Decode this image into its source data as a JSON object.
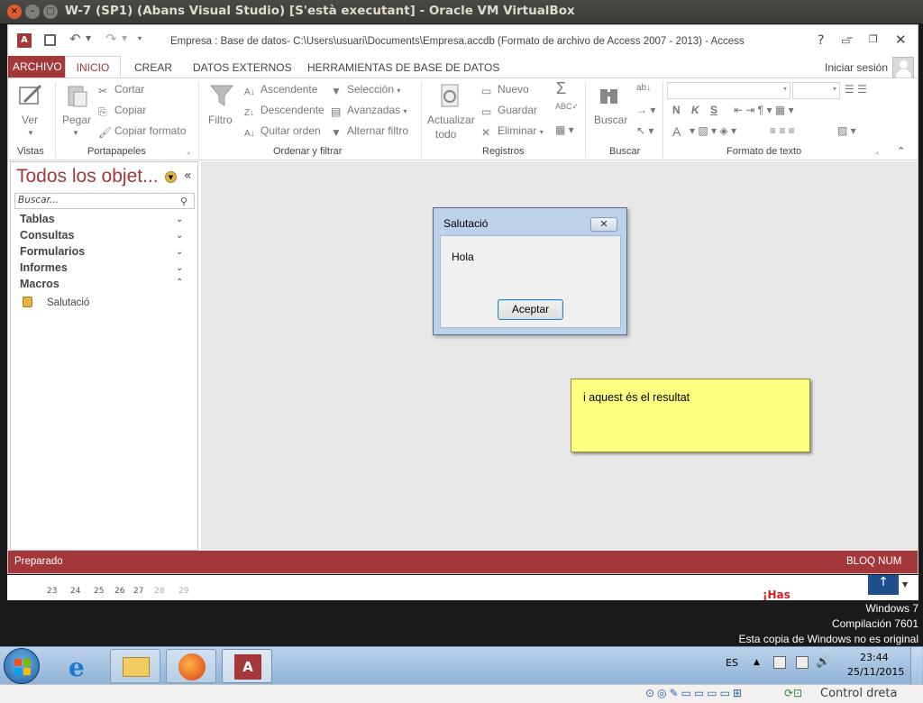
{
  "vbox": {
    "title": "W-7 (SP1) (Abans Visual Studio) [S'està executant] - Oracle VM VirtualBox",
    "host_key_label": "Control dreta"
  },
  "access": {
    "doc_title": "Empresa : Base de datos- C:\\Users\\usuari\\Documents\\Empresa.accdb (Formato de archivo de Access 2007 - 2013) - Access",
    "help": "?",
    "signin": "Iniciar sesión",
    "tabs": [
      "ARCHIVO",
      "INICIO",
      "CREAR",
      "DATOS EXTERNOS",
      "HERRAMIENTAS DE BASE DE DATOS"
    ],
    "ribbon": {
      "vistas": {
        "label": "Vistas",
        "ver": "Ver"
      },
      "portapapeles": {
        "label": "Portapapeles",
        "pegar": "Pegar",
        "cortar": "Cortar",
        "copiar": "Copiar",
        "copiar_formato": "Copiar formato"
      },
      "ordenar": {
        "label": "Ordenar y filtrar",
        "filtro": "Filtro",
        "ascendente": "Ascendente",
        "descendente": "Descendente",
        "quitar_orden": "Quitar orden",
        "seleccion": "Selección",
        "avanzadas": "Avanzadas",
        "alternar_filtro": "Alternar filtro"
      },
      "registros": {
        "label": "Registros",
        "actualizar": "Actualizar",
        "todo": "todo",
        "nuevo": "Nuevo",
        "guardar": "Guardar",
        "eliminar": "Eliminar"
      },
      "buscar": {
        "label": "Buscar",
        "buscar": "Buscar"
      },
      "formato": {
        "label": "Formato de texto",
        "bold": "N",
        "italic": "K",
        "underline": "S",
        "font_color": "A"
      }
    },
    "nav": {
      "title": "Todos los objet...",
      "search_placeholder": "Buscar...",
      "categories": [
        "Tablas",
        "Consultas",
        "Formularios",
        "Informes",
        "Macros"
      ],
      "macro_item": "Salutació"
    },
    "status": {
      "left": "Preparado",
      "right": "BLOQ NUM"
    }
  },
  "msgbox": {
    "title": "Salutació",
    "message": "Hola",
    "ok": "Aceptar"
  },
  "note": {
    "text": "i aquest és el resultat"
  },
  "calendar_strip": {
    "days": [
      "23",
      "24",
      "25",
      "26",
      "27",
      "28",
      "29"
    ],
    "partial_text": "¡Has"
  },
  "windows_info": {
    "line1": "Windows 7",
    "line2": "Compilación  7601",
    "line3": "Esta copia de Windows no es original"
  },
  "taskbar": {
    "lang": "ES",
    "time": "23:44",
    "date": "25/11/2015"
  }
}
